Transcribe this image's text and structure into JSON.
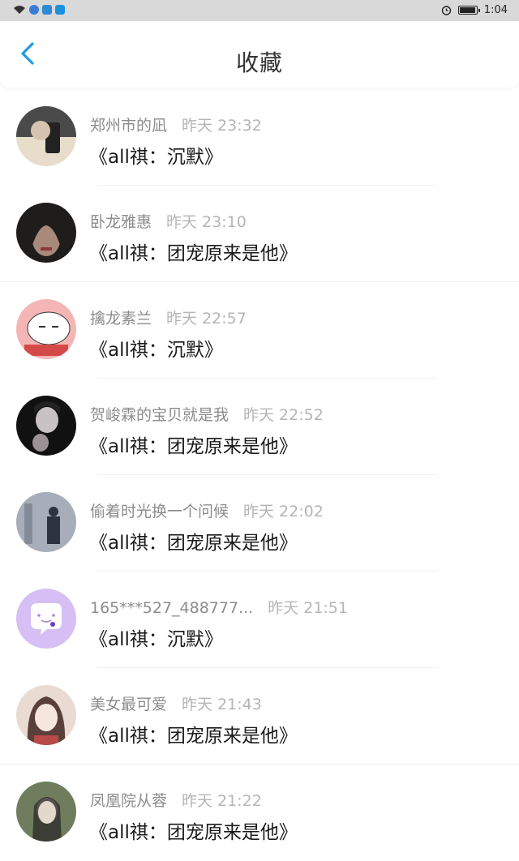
{
  "status_bar": {
    "time": "1:04",
    "icons": [
      "wifi-icon",
      "app-icon-1",
      "app-icon-2",
      "app-icon-3",
      "alarm-icon",
      "battery-icon"
    ],
    "colors": {
      "app1": "#3a7bd5",
      "app2": "#2f8bd6",
      "app3": "#1e90e0"
    }
  },
  "header": {
    "title": "收藏",
    "back_icon": "chevron-left-icon",
    "back_color": "#1e9be8"
  },
  "items": [
    {
      "username": "郑州市的凪",
      "time": "昨天 23:32",
      "book": "《all祺：沉默》",
      "avatar_colors": [
        "#4a4a4a",
        "#e8dccb"
      ]
    },
    {
      "username": "卧龙雅惠",
      "time": "昨天 23:10",
      "book": "《all祺：团宠原来是他》",
      "avatar_colors": [
        "#1f1d1c",
        "#a8897a"
      ]
    },
    {
      "username": "擒龙素兰",
      "time": "昨天 22:57",
      "book": "《all祺：沉默》",
      "avatar_colors": [
        "#f4b6b4",
        "#ffffff"
      ]
    },
    {
      "username": "贺峻霖的宝贝就是我",
      "time": "昨天 22:52",
      "book": "《all祺：团宠原来是他》",
      "avatar_colors": [
        "#111111",
        "#c9c2c4"
      ]
    },
    {
      "username": "偷着时光换一个问候",
      "time": "昨天 22:02",
      "book": "《all祺：团宠原来是他》",
      "avatar_colors": [
        "#7e8797",
        "#c8ced6"
      ]
    },
    {
      "username": "165***527_488777...",
      "time": "昨天 21:51",
      "book": "《all祺：沉默》",
      "avatar_colors": [
        "#d6bff4",
        "#ffffff"
      ]
    },
    {
      "username": "美女最可爱",
      "time": "昨天 21:43",
      "book": "《all祺：团宠原来是他》",
      "avatar_colors": [
        "#e9dbd2",
        "#5a3f3a"
      ]
    },
    {
      "username": "凤凰院从蓉",
      "time": "昨天 21:22",
      "book": "《all祺：团宠原来是他》",
      "avatar_colors": [
        "#6f7d5e",
        "#d9cfc2"
      ]
    }
  ]
}
